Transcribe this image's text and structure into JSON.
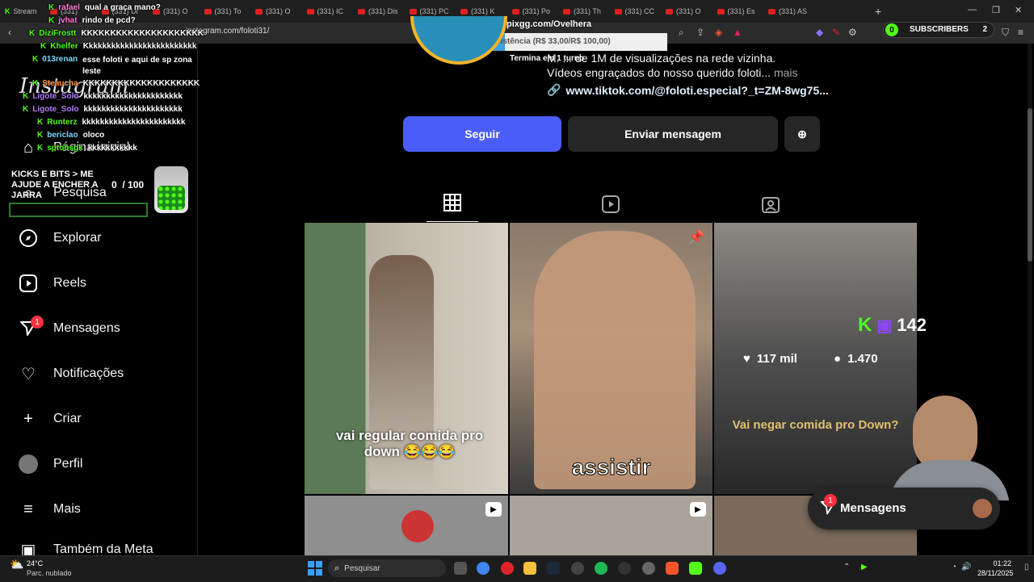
{
  "browser": {
    "tabs": [
      {
        "label": "Stream",
        "kind": "kick"
      },
      {
        "label": "(331)",
        "kind": "yt"
      },
      {
        "label": "(331) Ur",
        "kind": "yt"
      },
      {
        "label": "(331) O",
        "kind": "yt"
      },
      {
        "label": "(331) To",
        "kind": "yt"
      },
      {
        "label": "(331) O",
        "kind": "yt"
      },
      {
        "label": "(331) IC",
        "kind": "yt"
      },
      {
        "label": "(331) Dis",
        "kind": "yt"
      },
      {
        "label": "(331) PC",
        "kind": "yt"
      },
      {
        "label": "(331) K",
        "kind": "yt"
      },
      {
        "label": "(331) Po",
        "kind": "yt"
      },
      {
        "label": "(331) Th",
        "kind": "yt"
      },
      {
        "label": "(331) CC",
        "kind": "yt"
      },
      {
        "label": "(331) O",
        "kind": "yt"
      },
      {
        "label": "(331) Es",
        "kind": "yt"
      },
      {
        "label": "(331) AS",
        "kind": "yt"
      }
    ],
    "new_tab": "+",
    "url": "instagram.com/foloti31/"
  },
  "overlay": {
    "pix_url": "pixgg.com/Ovelhera",
    "goal_text": "subsistência (R$ 33,00/R$ 100,00)",
    "goal_progress": 0.33,
    "goal_end": "Termina em 1 turno",
    "subscribers_label": "SUBSCRIBERS",
    "subscribers_count": "0",
    "subscribers_goal": "2",
    "jar_title": "KICKS E BITS > ME AJUDE A ENCHER A JARRA",
    "jar_count": "0",
    "jar_total": "/ 100",
    "viewer_count": "142"
  },
  "chat": [
    {
      "user": "rafael",
      "color": "#ff7ad9",
      "msg": "qual a graça mano?"
    },
    {
      "user": "jvhat",
      "color": "#ff7ad9",
      "msg": "rindo de pcd?"
    },
    {
      "user": "DiziFrostt",
      "color": "#53fc18",
      "msg": "KKKKKKKKKKKKKKKKKKKKK"
    },
    {
      "user": "Khelfer",
      "color": "#53fc18",
      "msg": "Kkkkkkkkkkkkkkkkkkkkkkkkk"
    },
    {
      "user": "013renan",
      "color": "#7ad9ff",
      "msg": "esse foloti e aqui de sp zona leste"
    },
    {
      "user": "Steaucha",
      "color": "#ff9a3c",
      "msg": "KKKKKKKKKKKKKKKKKKKK"
    },
    {
      "user": "Ligote_Solo",
      "color": "#b67aff",
      "msg": "kkkkkkkkkkkkkkkkkkkkkk"
    },
    {
      "user": "Ligote_Solo",
      "color": "#b67aff",
      "msg": "kkkkkkkkkkkkkkkkkkkkkk"
    },
    {
      "user": "Runterz",
      "color": "#53fc18",
      "msg": "kkkkkkkkkkkkkkkkkkkkkkk"
    },
    {
      "user": "bericlao",
      "color": "#7ad9ff",
      "msg": "oloco"
    },
    {
      "user": "sptobsgk",
      "color": "#53fc18",
      "msg": "kkkkkkkkkkk"
    }
  ],
  "sidebar": {
    "logo": "Instagram",
    "items": [
      {
        "label": "Página inicial"
      },
      {
        "label": "Pesquisa"
      },
      {
        "label": "Explorar"
      },
      {
        "label": "Reels"
      },
      {
        "label": "Mensagens",
        "badge": "1"
      },
      {
        "label": "Notificações"
      },
      {
        "label": "Criar"
      },
      {
        "label": "Perfil"
      },
      {
        "label": "Mais"
      },
      {
        "label": "Também da Meta"
      }
    ]
  },
  "profile": {
    "bio_line1": "M. ... de 1M de visualizações na rede vizinha.",
    "bio_line2": "Vídeos engraçados do nosso querido foloti...",
    "bio_more": "mais",
    "link": "www.tiktok.com/@foloti.especial?_t=ZM-8wg75...",
    "follow_label": "Seguir",
    "message_label": "Enviar mensagem"
  },
  "posts": [
    {
      "caption": "vai regular comida pro down 😂😂😂"
    },
    {
      "caption": "assistir",
      "pinned": true
    },
    {
      "caption": "Vai negar comida pro Down?",
      "likes": "117 mil",
      "comments": "1.470"
    }
  ],
  "messages_bar": {
    "label": "Mensagens",
    "badge": "1"
  },
  "taskbar": {
    "weather_temp": "24°C",
    "weather_desc": "Parc. nublado",
    "search_placeholder": "Pesquisar",
    "time": "01:22",
    "date": "28/11/2025"
  }
}
